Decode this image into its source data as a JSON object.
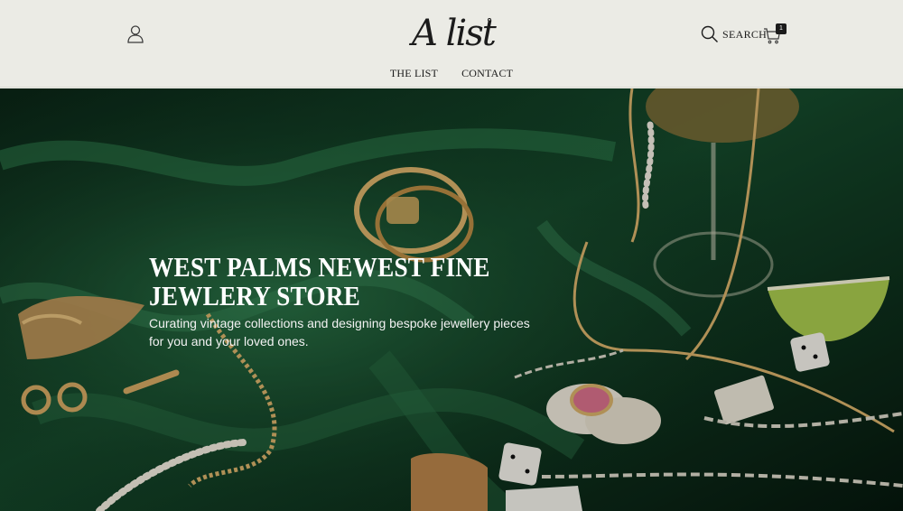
{
  "header": {
    "logo_text": "A list",
    "search_label": "SEARCH",
    "cart_count": "1"
  },
  "nav": {
    "items": [
      {
        "label": "THE LIST"
      },
      {
        "label": "CONTACT"
      }
    ]
  },
  "hero": {
    "title": "WEST PALMS NEWEST FINE JEWLERY STORE",
    "subtitle": "Curating vintage collections and designing bespoke jewellery pieces for you and your loved ones."
  },
  "icons": {
    "account": "user-icon",
    "search": "search-icon",
    "cart": "cart-icon"
  },
  "colors": {
    "header_bg": "#ebebe5",
    "text_dark": "#1b1b1b",
    "hero_green": "#0f3a22",
    "gold": "#c9a45c"
  }
}
